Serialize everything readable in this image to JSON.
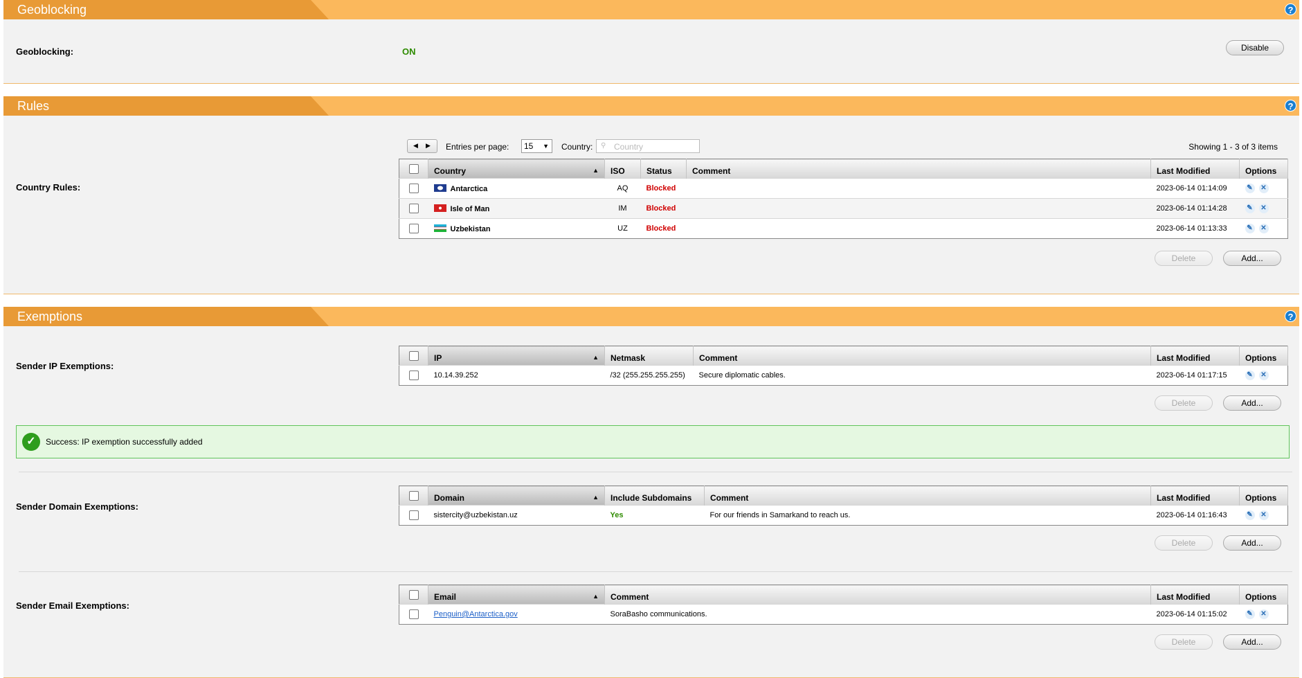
{
  "geoblocking": {
    "title": "Geoblocking",
    "label": "Geoblocking:",
    "status": "ON",
    "disable_label": "Disable"
  },
  "rules": {
    "title": "Rules",
    "label": "Country Rules:",
    "pager": {
      "entries_label": "Entries per page:",
      "entries_value": "15",
      "country_label": "Country:",
      "country_placeholder": "Country",
      "showing": "Showing 1 - 3 of 3 items"
    },
    "headers": {
      "country": "Country",
      "iso": "ISO",
      "status": "Status",
      "comment": "Comment",
      "last_modified": "Last Modified",
      "options": "Options"
    },
    "rows": [
      {
        "country": "Antarctica",
        "iso": "AQ",
        "status": "Blocked",
        "comment": "",
        "modified": "2023-06-14 01:14:09"
      },
      {
        "country": "Isle of Man",
        "iso": "IM",
        "status": "Blocked",
        "comment": "",
        "modified": "2023-06-14 01:14:28"
      },
      {
        "country": "Uzbekistan",
        "iso": "UZ",
        "status": "Blocked",
        "comment": "",
        "modified": "2023-06-14 01:13:33"
      }
    ],
    "delete_label": "Delete",
    "add_label": "Add..."
  },
  "exemptions": {
    "title": "Exemptions",
    "ip": {
      "label": "Sender IP Exemptions:",
      "headers": {
        "ip": "IP",
        "netmask": "Netmask",
        "comment": "Comment",
        "last_modified": "Last Modified",
        "options": "Options"
      },
      "rows": [
        {
          "ip": "10.14.39.252",
          "netmask": "/32 (255.255.255.255)",
          "comment": "Secure diplomatic cables.",
          "modified": "2023-06-14 01:17:15"
        }
      ],
      "delete_label": "Delete",
      "add_label": "Add..."
    },
    "success_message": "Success: IP exemption successfully added",
    "domain": {
      "label": "Sender Domain Exemptions:",
      "headers": {
        "domain": "Domain",
        "include_subdomains": "Include Subdomains",
        "comment": "Comment",
        "last_modified": "Last Modified",
        "options": "Options"
      },
      "rows": [
        {
          "domain": "sistercity@uzbekistan.uz",
          "include_subdomains": "Yes",
          "comment": "For our friends in Samarkand to reach us.",
          "modified": "2023-06-14 01:16:43"
        }
      ],
      "delete_label": "Delete",
      "add_label": "Add..."
    },
    "email": {
      "label": "Sender Email Exemptions:",
      "headers": {
        "email": "Email",
        "comment": "Comment",
        "last_modified": "Last Modified",
        "options": "Options"
      },
      "rows": [
        {
          "email": "Penguin@Antarctica.gov",
          "comment": "SoraBasho communications.",
          "modified": "2023-06-14 01:15:02"
        }
      ],
      "delete_label": "Delete",
      "add_label": "Add..."
    }
  },
  "icons": {
    "help": "help-icon",
    "edit": "pencil-icon",
    "delete": "close-icon",
    "success": "checkmark-icon",
    "search": "search-icon",
    "prev": "arrow-left-icon",
    "next": "arrow-right-icon"
  },
  "colors": {
    "header": "#fbb85c",
    "tab": "#e89a36",
    "blocked": "#d00000",
    "on": "#2e8b00",
    "success_bg": "#e5f8e1"
  }
}
